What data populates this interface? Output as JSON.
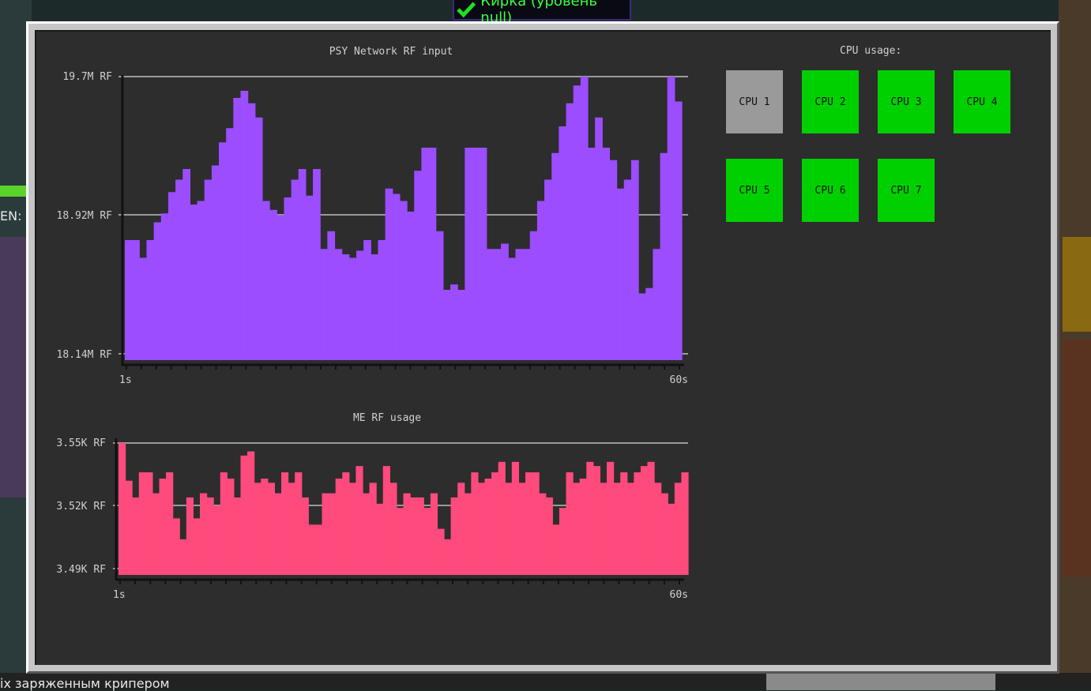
{
  "banner": {
    "text": "Кирка (уровень null)",
    "icon": "check-icon"
  },
  "background_texts": {
    "left_label": "ЕN:",
    "bottom_message": "іх заряженным крипером"
  },
  "colors": {
    "rf_input": "#9b4dff",
    "me_usage": "#ff4a7d",
    "cpu_busy": "#00d000",
    "cpu_idle": "#9a9a9a",
    "panel": "#2d2d2d"
  },
  "charts": {
    "rf_input": {
      "title": "PSY Network RF input",
      "y_labels": [
        "19.7M RF",
        "18.92M RF",
        "18.14M RF"
      ],
      "x_start": "1s",
      "x_end": "60s"
    },
    "me_usage": {
      "title": "ME RF usage",
      "y_labels": [
        "3.55K RF",
        "3.52K RF",
        "3.49K RF"
      ],
      "x_start": "1s",
      "x_end": "60s"
    }
  },
  "chart_data": [
    {
      "type": "bar",
      "title": "PSY Network RF input",
      "ylim": [
        18.14,
        19.7
      ],
      "y_unit": "M RF",
      "x_labels": [
        "1s",
        "60s"
      ],
      "values": [
        18.78,
        18.78,
        18.68,
        18.78,
        18.88,
        18.93,
        19.05,
        19.12,
        19.18,
        18.98,
        19.0,
        19.12,
        19.2,
        19.33,
        19.41,
        19.58,
        19.62,
        19.55,
        19.47,
        19.0,
        18.95,
        18.92,
        19.02,
        19.12,
        19.18,
        19.03,
        19.18,
        18.73,
        18.83,
        18.73,
        18.7,
        18.68,
        18.72,
        18.78,
        18.7,
        18.78,
        19.07,
        19.04,
        19.0,
        18.94,
        19.17,
        19.3,
        19.3,
        18.83,
        18.5,
        18.53,
        18.5,
        19.3,
        19.3,
        19.3,
        18.73,
        18.73,
        18.76,
        18.68,
        18.73,
        18.73,
        18.83,
        19.0,
        19.12,
        19.27,
        19.42,
        19.55,
        19.65,
        19.7,
        19.3,
        19.47,
        19.3,
        19.23,
        19.07,
        19.12,
        19.23,
        18.48,
        18.51,
        18.73,
        19.27,
        19.7,
        19.56
      ]
    },
    {
      "type": "bar",
      "title": "ME RF usage",
      "ylim": [
        3.49,
        3.55
      ],
      "y_unit": "K RF",
      "x_labels": [
        "1s",
        "60s"
      ],
      "values": [
        3.55,
        3.532,
        3.524,
        3.536,
        3.536,
        3.526,
        3.533,
        3.536,
        3.514,
        3.504,
        3.524,
        3.514,
        3.526,
        3.524,
        3.52,
        3.536,
        3.533,
        3.524,
        3.544,
        3.546,
        3.531,
        3.533,
        3.531,
        3.526,
        3.536,
        3.531,
        3.536,
        3.524,
        3.511,
        3.511,
        3.526,
        3.526,
        3.533,
        3.536,
        3.531,
        3.539,
        3.526,
        3.531,
        3.521,
        3.539,
        3.531,
        3.519,
        3.526,
        3.524,
        3.524,
        3.519,
        3.526,
        3.509,
        3.504,
        3.524,
        3.531,
        3.526,
        3.536,
        3.531,
        3.533,
        3.536,
        3.541,
        3.531,
        3.541,
        3.531,
        3.536,
        3.536,
        3.526,
        3.524,
        3.511,
        3.519,
        3.536,
        3.531,
        3.533,
        3.541,
        3.539,
        3.531,
        3.541,
        3.531,
        3.536,
        3.531,
        3.536,
        3.539,
        3.541,
        3.531,
        3.526,
        3.521,
        3.531,
        3.536
      ]
    }
  ],
  "cpu": {
    "title": "CPU usage:",
    "items": [
      {
        "label": "CPU 1",
        "state": "idle"
      },
      {
        "label": "CPU 2",
        "state": "busy"
      },
      {
        "label": "CPU 3",
        "state": "busy"
      },
      {
        "label": "CPU 4",
        "state": "busy"
      },
      {
        "label": "CPU 5",
        "state": "busy"
      },
      {
        "label": "CPU 6",
        "state": "busy"
      },
      {
        "label": "CPU 7",
        "state": "busy"
      }
    ]
  }
}
